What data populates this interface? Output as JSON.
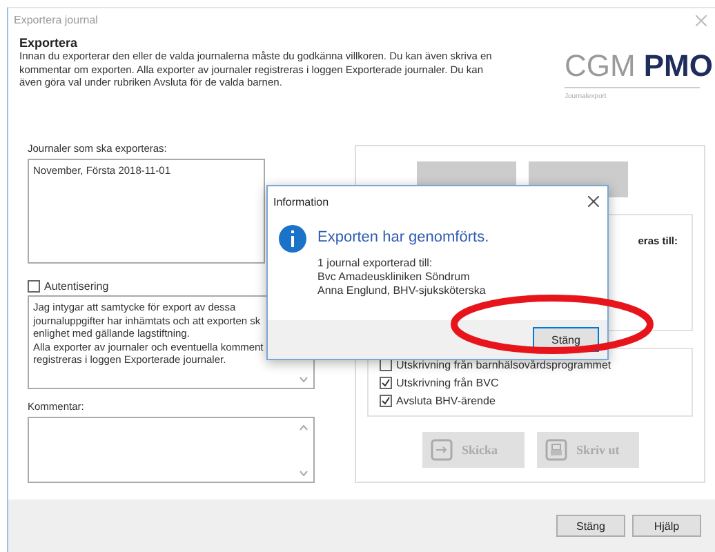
{
  "window": {
    "title": "Exportera journal"
  },
  "header": {
    "title": "Exportera",
    "description": "Innan du exporterar den eller de valda journalerna måste du godkänna villkoren. Du kan även skriva en kommentar om exporten. Alla exporter av journaler registreras i loggen Exporterade journaler. Du kan även göra val under rubriken Avsluta för de valda barnen.",
    "logo": {
      "part_1": "CGM",
      "part_2": "PMO",
      "subtitle": "Journalexport"
    }
  },
  "journals": {
    "label": "Journaler som ska exporteras:",
    "value": "November, Första 2018-11-01"
  },
  "authentication": {
    "label": "Autentisering",
    "checked": false,
    "lines": [
      "Jag intygar att samtycke för export av dessa",
      "journaluppgifter har inhämtats och att exporten sk",
      "enlighet med gällande lagstiftning.",
      "Alla exporter av journaler och eventuella komment",
      "registreras i loggen Exporterade journaler."
    ]
  },
  "comment": {
    "label": "Kommentar:"
  },
  "recipient": {
    "label": "eras till:"
  },
  "finish_options": [
    {
      "label": "Utskrivning från barnhälsovårdsprogrammet",
      "checked": false
    },
    {
      "label": "Utskrivning från BVC",
      "checked": true
    },
    {
      "label": "Avsluta BHV-ärende",
      "checked": true
    }
  ],
  "actions": [
    {
      "kind": "send",
      "label": "Skicka",
      "disabled": true
    },
    {
      "kind": "print",
      "label": "Skriv ut",
      "disabled": true
    }
  ],
  "footer_buttons": [
    "Stäng",
    "Hjälp"
  ],
  "dialog": {
    "title": "Information",
    "heading": "Exporten har genomförts.",
    "lines": [
      "1 journal exporterad till:",
      "Bvc Amadeuskliniken Söndrum",
      "Anna Englund, BHV-sjuksköterska"
    ],
    "button": "Stäng"
  },
  "annotation": {
    "kind": "ellipse"
  }
}
